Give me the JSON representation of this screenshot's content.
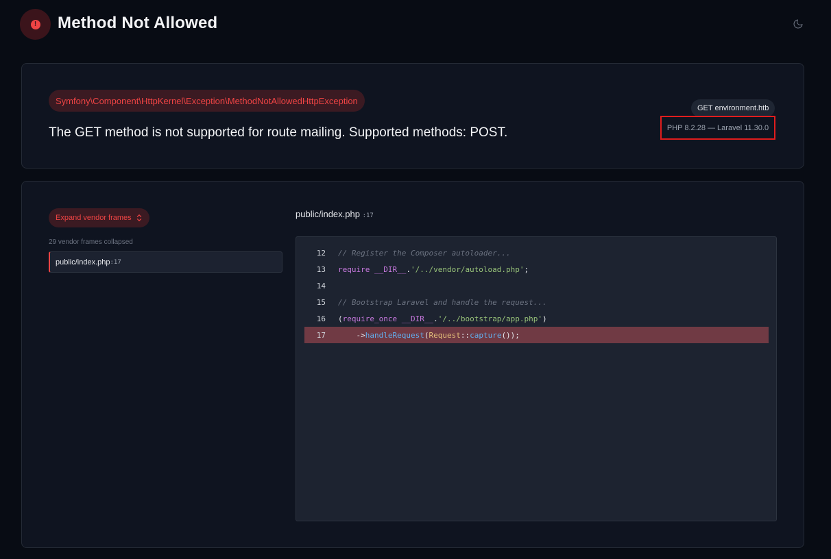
{
  "header": {
    "title": "Method Not Allowed",
    "logo_icon": "exclamation-circle-icon",
    "theme_icon": "moon-icon",
    "colors": {
      "background": "#080c14",
      "accent": "#ef4444",
      "accent_bg": "#3b141b"
    }
  },
  "exception": {
    "class": "Symfony\\Component\\HttpKernel\\Exception\\MethodNotAllowedHttpException",
    "message": "The GET method is not supported for route mailing. Supported methods: POST.",
    "request": "GET environment.htb",
    "versions": "PHP 8.2.28 — Laravel 11.30.0"
  },
  "trace": {
    "expand_label": "Expand vendor frames",
    "expand_icon": "chevron-up-down-icon",
    "collapsed_note": "29 vendor frames collapsed",
    "frames": [
      {
        "file": "public/index.php",
        "line": ":17"
      }
    ],
    "current_file": "public/index.php",
    "current_line": ":17"
  },
  "code": {
    "lines": [
      {
        "num": "12",
        "text": "// Register the Composer autoloader..."
      },
      {
        "num": "13",
        "text": "require __DIR__.'/../vendor/autoload.php';"
      },
      {
        "num": "14",
        "text": ""
      },
      {
        "num": "15",
        "text": "// Bootstrap Laravel and handle the request..."
      },
      {
        "num": "16",
        "text": "(require_once __DIR__.'/../bootstrap/app.php')"
      },
      {
        "num": "17",
        "text": "    ->handleRequest(Request::capture());"
      }
    ],
    "highlight_line": "17"
  }
}
